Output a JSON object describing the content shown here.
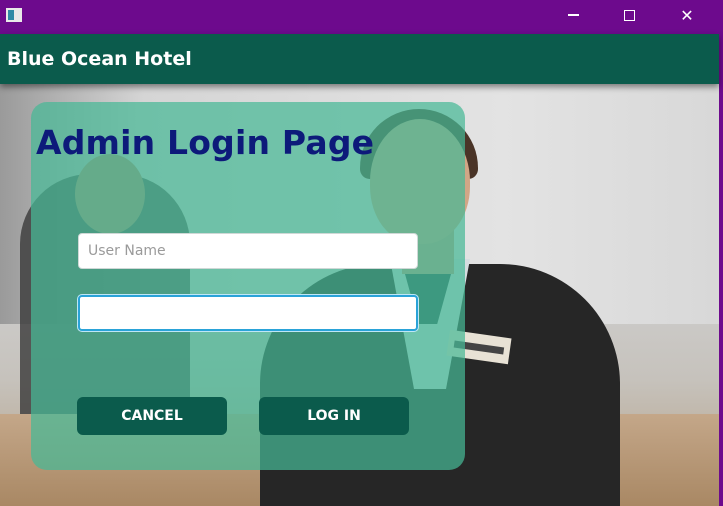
{
  "window": {
    "minimize_glyph": "",
    "close_glyph": "✕"
  },
  "header": {
    "title": "Blue Ocean Hotel"
  },
  "login": {
    "title": "Admin Login Page",
    "username": {
      "placeholder": "User Name",
      "value": ""
    },
    "password": {
      "placeholder": "",
      "value": ""
    },
    "cancel_label": "CANCEL",
    "login_label": "LOG IN"
  },
  "colors": {
    "titlebar": "#6d0a8d",
    "header": "#0b5b4c",
    "card": "#47b896",
    "title_text": "#0d1a7a",
    "button": "#0b5b4c",
    "focus_border": "#2aa3d8"
  },
  "icons": {
    "app": "app-window-icon",
    "minimize": "minimize-icon",
    "maximize": "maximize-icon",
    "close": "close-icon"
  }
}
